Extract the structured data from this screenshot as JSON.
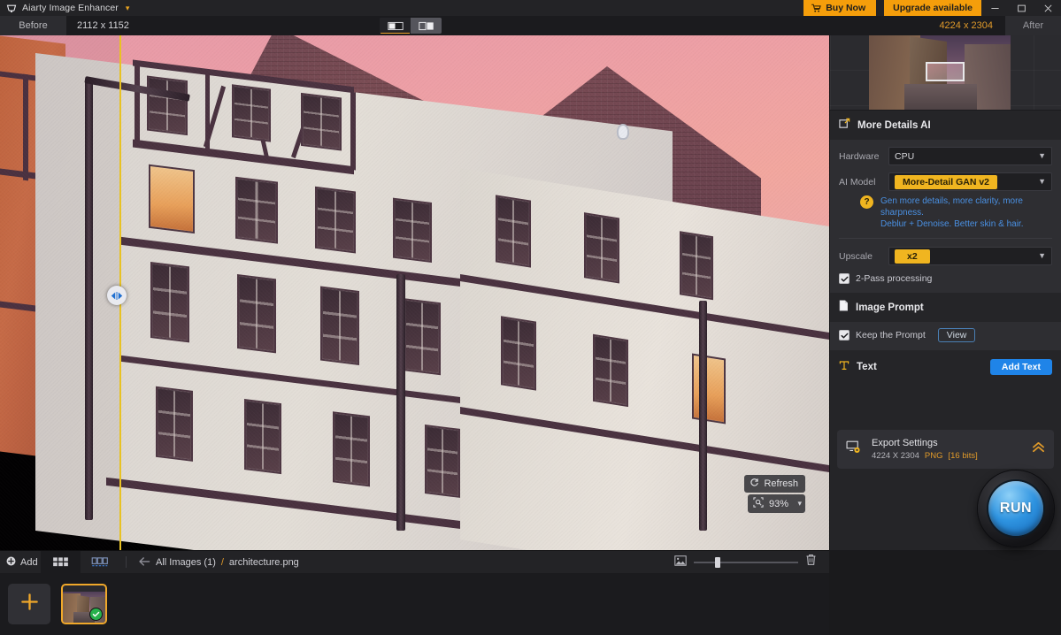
{
  "titlebar": {
    "app_name": "Aiarty Image Enhancer",
    "logo_icon": "aiarty-logo-icon",
    "dropdown_icon": "chevron-down-icon",
    "buy_now_label": "Buy Now",
    "buy_now_icon": "cart-icon",
    "upgrade_label": "Upgrade available",
    "minimize_icon": "minimize-icon",
    "maximize_icon": "maximize-icon",
    "close_icon": "close-icon"
  },
  "subbar": {
    "before_label": "Before",
    "before_dimensions": "2112 x 1152",
    "after_dimensions": "4224 x 2304",
    "after_label": "After",
    "view_modes": [
      {
        "name": "split-vertical-view",
        "active": true
      },
      {
        "name": "side-by-side-view",
        "active": false
      }
    ]
  },
  "canvas": {
    "refresh_label": "Refresh",
    "refresh_icon": "refresh-icon",
    "zoom_icon": "zoom-fit-icon",
    "zoom_value": "93%",
    "zoom_chevron": "chevron-down-icon",
    "split_handle_icon": "split-compare-handle-icon"
  },
  "panel": {
    "navigator": {
      "name": "navigator-preview"
    },
    "more_details": {
      "icon": "more-details-ai-icon",
      "title": "More Details AI",
      "hardware_label": "Hardware",
      "hardware_value": "CPU",
      "ai_model_label": "AI Model",
      "ai_model_value": "More-Detail GAN v2",
      "help_icon": "question-mark-icon",
      "hint_line1": "Gen more details, more clarity, more sharpness.",
      "hint_line2": "Deblur + Denoise. Better skin & hair.",
      "upscale_label": "Upscale",
      "upscale_value": "x2",
      "two_pass_label": "2-Pass processing",
      "two_pass_checked": true,
      "chevron_icon": "chevron-down-icon"
    },
    "image_prompt": {
      "icon": "document-icon",
      "title": "Image Prompt",
      "keep_prompt_label": "Keep the Prompt",
      "keep_prompt_checked": true,
      "view_label": "View"
    },
    "text_section": {
      "icon": "text-tool-icon",
      "title": "Text",
      "add_text_label": "Add Text"
    },
    "export": {
      "icon": "export-settings-icon",
      "title": "Export Settings",
      "dimensions": "4224 X 2304",
      "format": "PNG",
      "bit_depth": "[16 bits]",
      "collapse_icon": "double-chevron-up-icon"
    },
    "run_label": "RUN"
  },
  "bottombar": {
    "add_label": "Add",
    "add_icon": "plus-circle-icon",
    "grid_view_icon": "grid-view-icon",
    "filmstrip_view_icon": "filmstrip-view-icon",
    "back_icon": "arrow-left-icon",
    "all_images_label": "All Images (1)",
    "separator": "/",
    "current_file": "architecture.png",
    "thumb_size_icon": "image-size-icon",
    "delete_icon": "trash-icon"
  },
  "filmstrip": {
    "add_tile_icon": "plus-icon",
    "thumbnail_name": "architecture-thumbnail",
    "done_badge_icon": "check-icon"
  },
  "colors": {
    "accent_orange": "#f59e0b",
    "accent_yellow": "#f0b520",
    "accent_blue": "#1f84e8",
    "hint_blue": "#4a90e2",
    "panel_bg": "#252528",
    "panel_section_bg": "#2e2e32",
    "titlebar_bg": "#232326",
    "success_green": "#28b14c"
  }
}
